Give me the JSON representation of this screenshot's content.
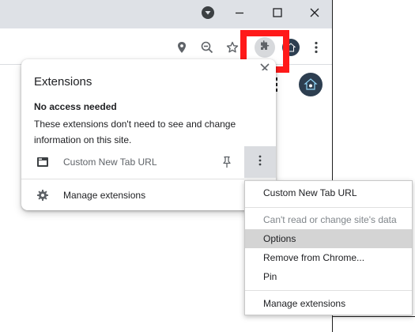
{
  "extensions_panel": {
    "title": "Extensions",
    "section_heading": "No access needed",
    "section_description": "These extensions don't need to see and change information on this site.",
    "extension_name": "Custom New Tab URL",
    "manage_label": "Manage extensions"
  },
  "context_menu": {
    "items": [
      {
        "label": "Custom New Tab URL",
        "disabled": false
      },
      {
        "label": "Can't read or change site's data",
        "disabled": true
      },
      {
        "label": "Options",
        "disabled": false,
        "highlighted": true
      },
      {
        "label": "Remove from Chrome...",
        "disabled": false
      },
      {
        "label": "Pin",
        "disabled": false
      },
      {
        "label": "Manage extensions",
        "disabled": false
      }
    ]
  },
  "colors": {
    "highlight_box": "#ff1a1a",
    "titlebar": "#dee1e6",
    "menu_hover": "#d4d4d4"
  },
  "icons": [
    "media-control-icon",
    "minimize-icon",
    "maximize-icon",
    "close-icon",
    "location-icon",
    "zoom-out-icon",
    "bookmark-star-icon",
    "puzzle-icon",
    "avatar-icon",
    "more-vert-icon",
    "pin-icon",
    "gear-icon"
  ]
}
